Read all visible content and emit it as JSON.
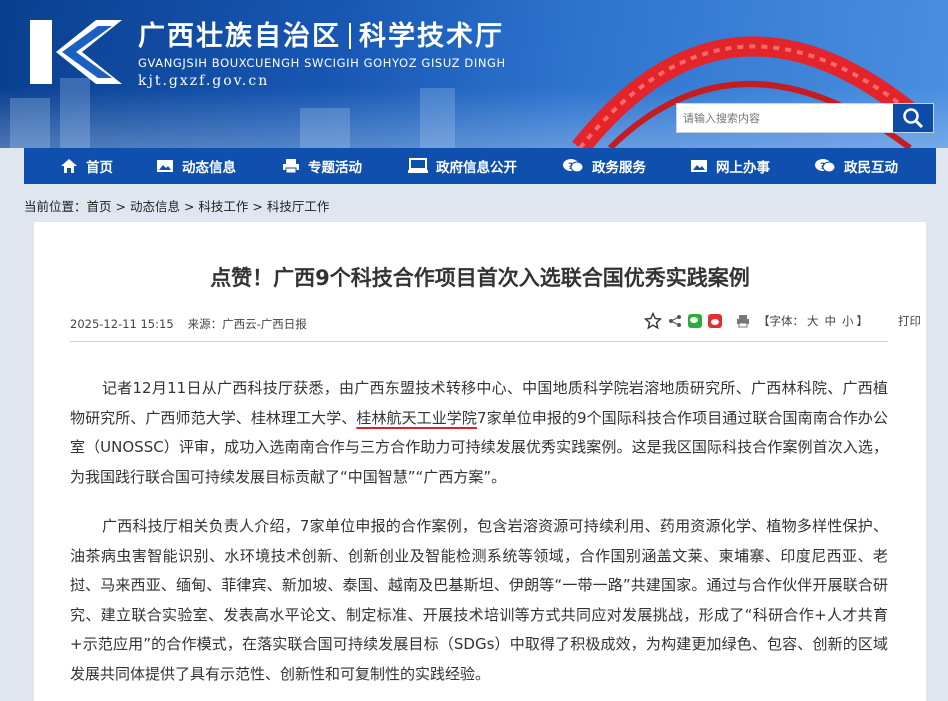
{
  "header": {
    "org": "广西壮族自治区",
    "dept": "科学技术厅",
    "subtitle": "GVANGJSIH BOUXCUENGH SWCIGIH GOHYOZ GISUZ DINGH",
    "url": "kjt.gxzf.gov.cn",
    "search_placeholder": "请输入搜索内容"
  },
  "nav": [
    {
      "label": "首页",
      "icon": "home-icon"
    },
    {
      "label": "动态信息",
      "icon": "image-icon"
    },
    {
      "label": "专题活动",
      "icon": "printer-icon"
    },
    {
      "label": "政府信息公开",
      "icon": "monitor-icon"
    },
    {
      "label": "政务服务",
      "icon": "chat-icon"
    },
    {
      "label": "网上办事",
      "icon": "picture-icon"
    },
    {
      "label": "政民互动",
      "icon": "chat-icon"
    }
  ],
  "breadcrumb": {
    "prefix": "当前位置：",
    "items": [
      "首页",
      "动态信息",
      "科技工作",
      "科技厅工作"
    ]
  },
  "article": {
    "title": "点赞！广西9个科技合作项目首次入选联合国优秀实践案例",
    "date": "2025-12-11 15:15",
    "source": "来源：广西云-广西日报",
    "font_label": "【字体：",
    "font_large": "大",
    "font_mid": "中",
    "font_small": "小",
    "font_close": "】",
    "print": "打印",
    "p1_a": "记者12月11日从广西科技厅获悉，由广西东盟技术转移中心、中国地质科学院岩溶地质研究所、广西林科院、广西植物研究所、广西师范大学、桂林理工大学、",
    "p1_ul": "桂林航天工业学院",
    "p1_b": "7家单位申报的9个国际科技合作项目通过联合国南南合作办公室（UNOSSC）评审，成功入选南南合作与三方合作助力可持续发展优秀实践案例。这是我区国际科技合作案例首次入选，为我国践行联合国可持续发展目标贡献了“中国智慧”“广西方案”。",
    "p2": "广西科技厅相关负责人介绍，7家单位申报的合作案例，包含岩溶资源可持续利用、药用资源化学、植物多样性保护、油茶病虫害智能识别、水环境技术创新、创新创业及智能检测系统等领域，合作国别涵盖文莱、柬埔寨、印度尼西亚、老挝、马来西亚、缅甸、菲律宾、新加坡、泰国、越南及巴基斯坦、伊朗等“一带一路”共建国家。通过与合作伙伴开展联合研究、建立联合实验室、发表高水平论文、制定标准、开展技术培训等方式共同应对发展挑战，形成了“科研合作+人才共育+示范应用”的合作模式，在落实联合国可持续发展目标（SDGs）中取得了积极成效，为构建更加绿色、包容、创新的区域发展共同体提供了具有示范性、创新性和可复制性的实践经验。"
  },
  "colors": {
    "nav_bg": "#0f4fae",
    "accent_red": "#d22"
  }
}
